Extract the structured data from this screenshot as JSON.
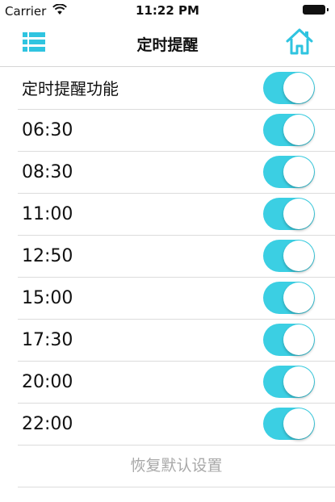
{
  "status_bar": {
    "carrier": "Carrier",
    "time": "11:22 PM",
    "wifi_icon": "wifi-icon",
    "battery_icon": "battery-full-icon"
  },
  "nav": {
    "title": "定时提醒",
    "menu_icon": "list-menu-icon",
    "home_icon": "home-icon",
    "accent_color": "#2fc4e0"
  },
  "master_toggle": {
    "label": "定时提醒功能",
    "on": true
  },
  "reminders": [
    {
      "time": "06:30",
      "on": true
    },
    {
      "time": "08:30",
      "on": true
    },
    {
      "time": "11:00",
      "on": true
    },
    {
      "time": "12:50",
      "on": true
    },
    {
      "time": "15:00",
      "on": true
    },
    {
      "time": "17:30",
      "on": true
    },
    {
      "time": "20:00",
      "on": true
    },
    {
      "time": "22:00",
      "on": true
    }
  ],
  "reset_button": {
    "label": "恢复默认设置"
  },
  "colors": {
    "toggle_on": "#3bcfe3",
    "reset_text": "#a8a8a8"
  }
}
